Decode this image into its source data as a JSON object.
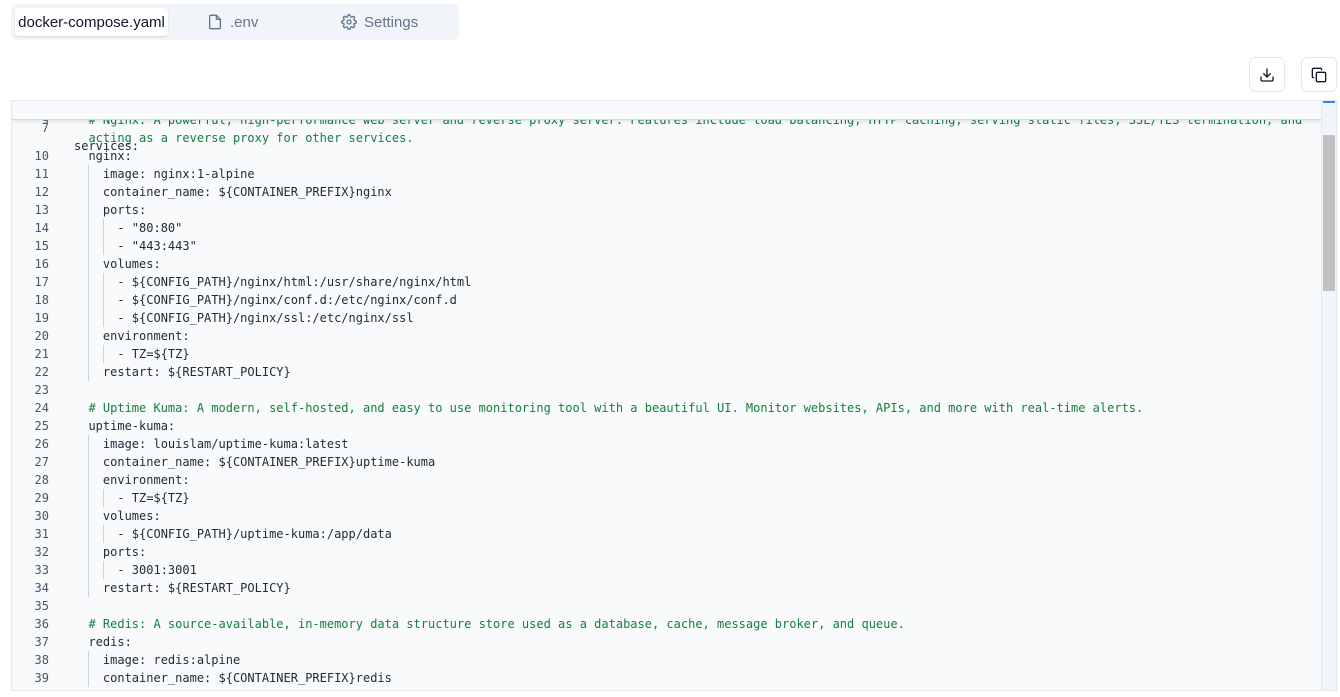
{
  "tabs": [
    {
      "label": "docker-compose.yaml",
      "icon": "none",
      "active": true
    },
    {
      "label": ".env",
      "icon": "file-icon",
      "active": false
    },
    {
      "label": "Settings",
      "icon": "gear-icon",
      "active": false
    }
  ],
  "toolbar": {
    "download_icon": "download-icon",
    "copy_icon": "copy-icon"
  },
  "editor": {
    "sticky_line": {
      "num": "7",
      "text": "services:"
    },
    "lines": [
      {
        "num": "9",
        "text": "  # Nginx: A powerful, high-performance web server and reverse proxy server. Features include load balancing, HTTP caching, serving static files, SSL/TLS termination, and",
        "type": "comment"
      },
      {
        "num": "",
        "text": "  acting as a reverse proxy for other services.",
        "type": "comment"
      },
      {
        "num": "10",
        "text": "  nginx:",
        "type": "code"
      },
      {
        "num": "11",
        "text": "    image: nginx:1-alpine",
        "type": "code"
      },
      {
        "num": "12",
        "text": "    container_name: ${CONTAINER_PREFIX}nginx",
        "type": "code"
      },
      {
        "num": "13",
        "text": "    ports:",
        "type": "code"
      },
      {
        "num": "14",
        "text": "      - \"80:80\"",
        "type": "code"
      },
      {
        "num": "15",
        "text": "      - \"443:443\"",
        "type": "code"
      },
      {
        "num": "16",
        "text": "    volumes:",
        "type": "code"
      },
      {
        "num": "17",
        "text": "      - ${CONFIG_PATH}/nginx/html:/usr/share/nginx/html",
        "type": "code"
      },
      {
        "num": "18",
        "text": "      - ${CONFIG_PATH}/nginx/conf.d:/etc/nginx/conf.d",
        "type": "code"
      },
      {
        "num": "19",
        "text": "      - ${CONFIG_PATH}/nginx/ssl:/etc/nginx/ssl",
        "type": "code"
      },
      {
        "num": "20",
        "text": "    environment:",
        "type": "code"
      },
      {
        "num": "21",
        "text": "      - TZ=${TZ}",
        "type": "code"
      },
      {
        "num": "22",
        "text": "    restart: ${RESTART_POLICY}",
        "type": "code"
      },
      {
        "num": "23",
        "text": "",
        "type": "code"
      },
      {
        "num": "24",
        "text": "  # Uptime Kuma: A modern, self-hosted, and easy to use monitoring tool with a beautiful UI. Monitor websites, APIs, and more with real-time alerts.",
        "type": "comment"
      },
      {
        "num": "25",
        "text": "  uptime-kuma:",
        "type": "code"
      },
      {
        "num": "26",
        "text": "    image: louislam/uptime-kuma:latest",
        "type": "code"
      },
      {
        "num": "27",
        "text": "    container_name: ${CONTAINER_PREFIX}uptime-kuma",
        "type": "code"
      },
      {
        "num": "28",
        "text": "    environment:",
        "type": "code"
      },
      {
        "num": "29",
        "text": "      - TZ=${TZ}",
        "type": "code"
      },
      {
        "num": "30",
        "text": "    volumes:",
        "type": "code"
      },
      {
        "num": "31",
        "text": "      - ${CONFIG_PATH}/uptime-kuma:/app/data",
        "type": "code"
      },
      {
        "num": "32",
        "text": "    ports:",
        "type": "code"
      },
      {
        "num": "33",
        "text": "      - 3001:3001",
        "type": "code"
      },
      {
        "num": "34",
        "text": "    restart: ${RESTART_POLICY}",
        "type": "code"
      },
      {
        "num": "35",
        "text": "",
        "type": "code"
      },
      {
        "num": "36",
        "text": "  # Redis: A source-available, in-memory data structure store used as a database, cache, message broker, and queue.",
        "type": "comment"
      },
      {
        "num": "37",
        "text": "  redis:",
        "type": "code"
      },
      {
        "num": "38",
        "text": "    image: redis:alpine",
        "type": "code"
      },
      {
        "num": "39",
        "text": "    container_name: ${CONTAINER_PREFIX}redis",
        "type": "code"
      }
    ]
  }
}
